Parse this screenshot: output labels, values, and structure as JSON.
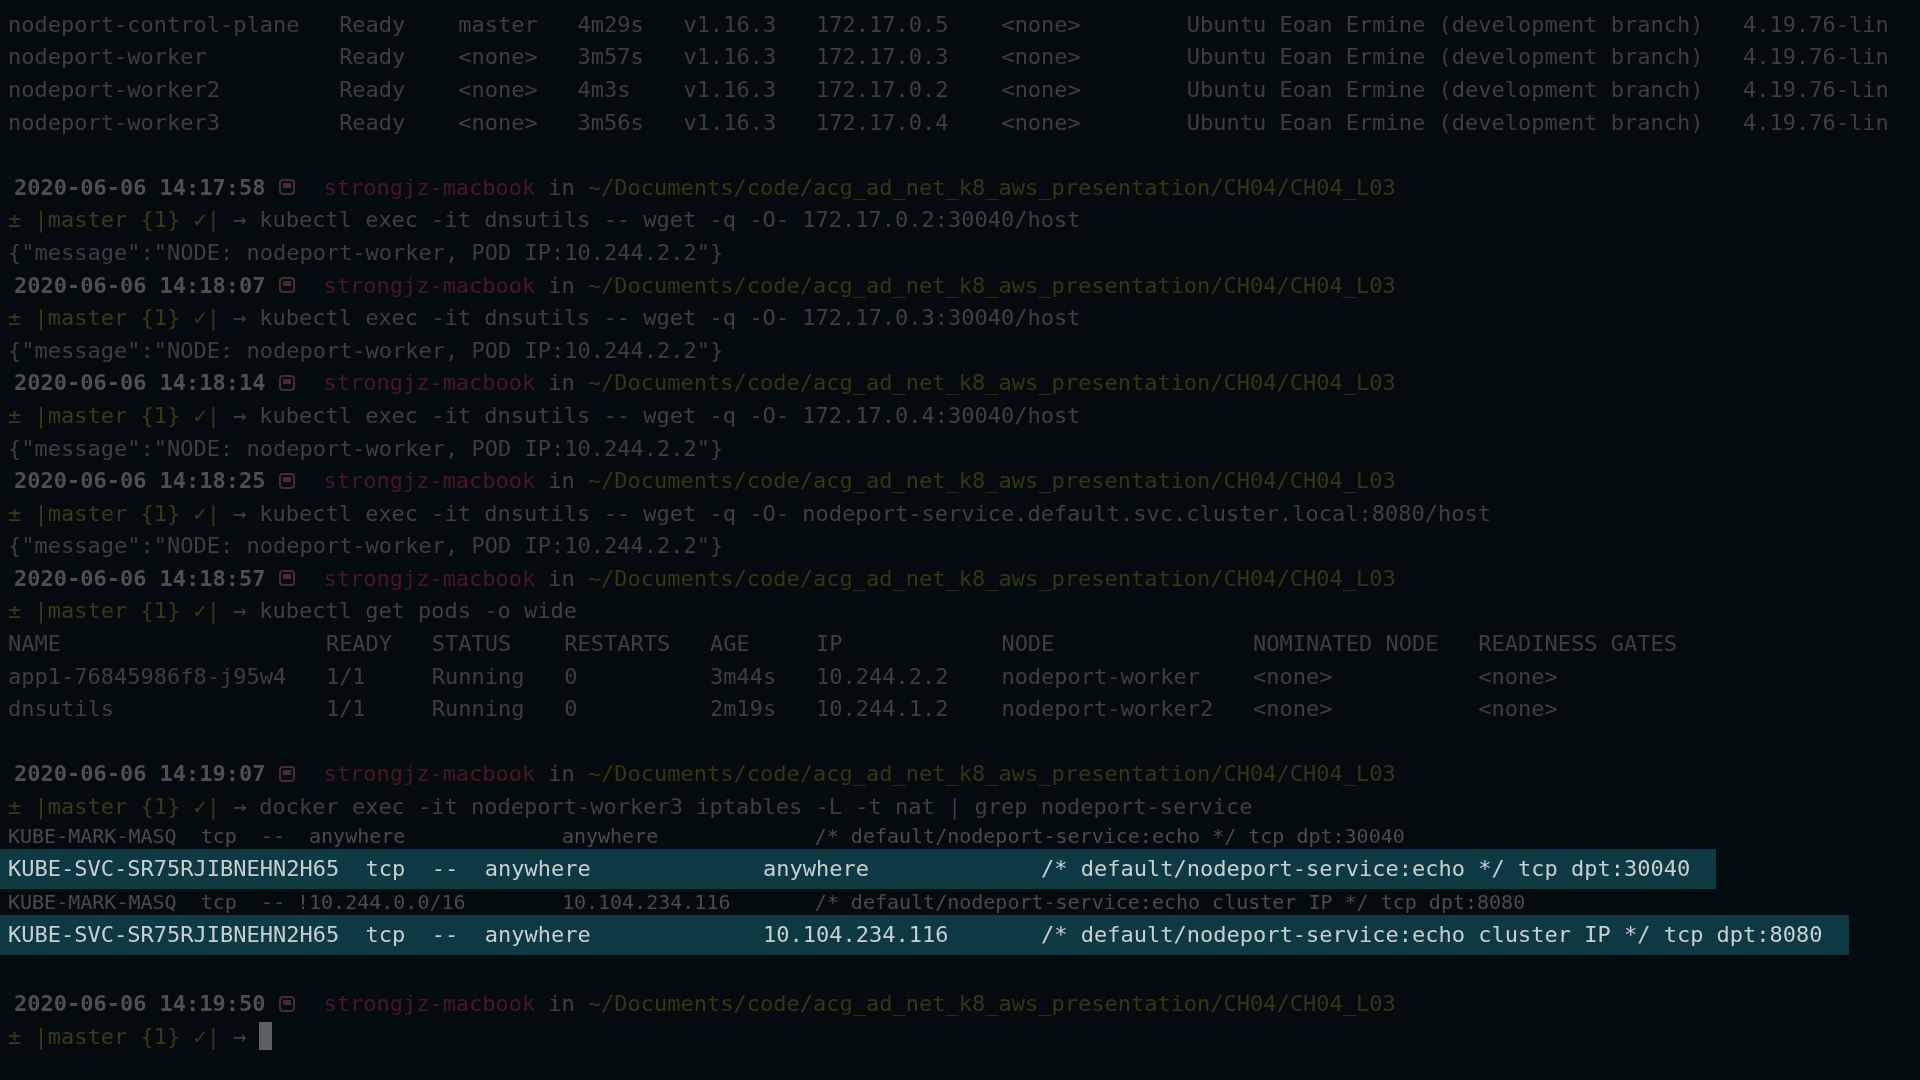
{
  "terminal": {
    "lines": [
      {
        "kind": "output",
        "text": "nodeport-control-plane   Ready    master   4m29s   v1.16.3   172.17.0.5    <none>        Ubuntu Eoan Ermine (development branch)   4.19.76-lin"
      },
      {
        "kind": "output",
        "text": "nodeport-worker          Ready    <none>   3m57s   v1.16.3   172.17.0.3    <none>        Ubuntu Eoan Ermine (development branch)   4.19.76-lin"
      },
      {
        "kind": "output",
        "text": "nodeport-worker2         Ready    <none>   4m3s    v1.16.3   172.17.0.2    <none>        Ubuntu Eoan Ermine (development branch)   4.19.76-lin"
      },
      {
        "kind": "output",
        "text": "nodeport-worker3         Ready    <none>   3m56s   v1.16.3   172.17.0.4    <none>        Ubuntu Eoan Ermine (development branch)   4.19.76-lin"
      },
      {
        "kind": "blank"
      },
      {
        "kind": "prompt",
        "date": "2020-06-06",
        "time": "14:17:58",
        "host": "strongjz-macbook",
        "in": "in",
        "path": "~/Documents/code/acg_ad_net_k8_aws_presentation/CH04/CH04_L03"
      },
      {
        "kind": "command",
        "git": "± |master {1} ✓|",
        "arrow": "→",
        "command": "kubectl exec -it dnsutils -- wget -q -O- 172.17.0.2:30040/host"
      },
      {
        "kind": "output",
        "text": "{\"message\":\"NODE: nodeport-worker, POD IP:10.244.2.2\"}"
      },
      {
        "kind": "prompt",
        "date": "2020-06-06",
        "time": "14:18:07",
        "host": "strongjz-macbook",
        "in": "in",
        "path": "~/Documents/code/acg_ad_net_k8_aws_presentation/CH04/CH04_L03"
      },
      {
        "kind": "command",
        "git": "± |master {1} ✓|",
        "arrow": "→",
        "command": "kubectl exec -it dnsutils -- wget -q -O- 172.17.0.3:30040/host"
      },
      {
        "kind": "output",
        "text": "{\"message\":\"NODE: nodeport-worker, POD IP:10.244.2.2\"}"
      },
      {
        "kind": "prompt",
        "date": "2020-06-06",
        "time": "14:18:14",
        "host": "strongjz-macbook",
        "in": "in",
        "path": "~/Documents/code/acg_ad_net_k8_aws_presentation/CH04/CH04_L03"
      },
      {
        "kind": "command",
        "git": "± |master {1} ✓|",
        "arrow": "→",
        "command": "kubectl exec -it dnsutils -- wget -q -O- 172.17.0.4:30040/host"
      },
      {
        "kind": "output",
        "text": "{\"message\":\"NODE: nodeport-worker, POD IP:10.244.2.2\"}"
      },
      {
        "kind": "prompt",
        "date": "2020-06-06",
        "time": "14:18:25",
        "host": "strongjz-macbook",
        "in": "in",
        "path": "~/Documents/code/acg_ad_net_k8_aws_presentation/CH04/CH04_L03"
      },
      {
        "kind": "command",
        "git": "± |master {1} ✓|",
        "arrow": "→",
        "command": "kubectl exec -it dnsutils -- wget -q -O- nodeport-service.default.svc.cluster.local:8080/host"
      },
      {
        "kind": "output",
        "text": "{\"message\":\"NODE: nodeport-worker, POD IP:10.244.2.2\"}"
      },
      {
        "kind": "prompt",
        "date": "2020-06-06",
        "time": "14:18:57",
        "host": "strongjz-macbook",
        "in": "in",
        "path": "~/Documents/code/acg_ad_net_k8_aws_presentation/CH04/CH04_L03"
      },
      {
        "kind": "command",
        "git": "± |master {1} ✓|",
        "arrow": "→",
        "command": "kubectl get pods -o wide"
      },
      {
        "kind": "output",
        "text": "NAME                    READY   STATUS    RESTARTS   AGE     IP            NODE               NOMINATED NODE   READINESS GATES"
      },
      {
        "kind": "output",
        "text": "app1-76845986f8-j95w4   1/1     Running   0          3m44s   10.244.2.2    nodeport-worker    <none>           <none>"
      },
      {
        "kind": "output",
        "text": "dnsutils                1/1     Running   0          2m19s   10.244.1.2    nodeport-worker2   <none>           <none>"
      },
      {
        "kind": "blank"
      },
      {
        "kind": "prompt",
        "date": "2020-06-06",
        "time": "14:19:07",
        "host": "strongjz-macbook",
        "in": "in",
        "path": "~/Documents/code/acg_ad_net_k8_aws_presentation/CH04/CH04_L03"
      },
      {
        "kind": "command",
        "git": "± |master {1} ✓|",
        "arrow": "→",
        "command": "docker exec -it nodeport-worker3 iptables -L -t nat | grep nodeport-service"
      },
      {
        "kind": "small",
        "text": "KUBE-MARK-MASQ  tcp  --  anywhere             anywhere             /* default/nodeport-service:echo */ tcp dpt:30040"
      },
      {
        "kind": "highlight",
        "text": "KUBE-SVC-SR75RJIBNEHN2H65  tcp  --  anywhere             anywhere             /* default/nodeport-service:echo */ tcp dpt:30040"
      },
      {
        "kind": "small",
        "text": "KUBE-MARK-MASQ  tcp  -- !10.244.0.0/16        10.104.234.116       /* default/nodeport-service:echo cluster IP */ tcp dpt:8080"
      },
      {
        "kind": "highlight",
        "text": "KUBE-SVC-SR75RJIBNEHN2H65  tcp  --  anywhere             10.104.234.116       /* default/nodeport-service:echo cluster IP */ tcp dpt:8080"
      },
      {
        "kind": "blank"
      },
      {
        "kind": "prompt",
        "date": "2020-06-06",
        "time": "14:19:50",
        "host": "strongjz-macbook",
        "in": "in",
        "path": "~/Documents/code/acg_ad_net_k8_aws_presentation/CH04/CH04_L03"
      },
      {
        "kind": "cursor",
        "git": "± |master {1} ✓|",
        "arrow": "→"
      }
    ]
  }
}
